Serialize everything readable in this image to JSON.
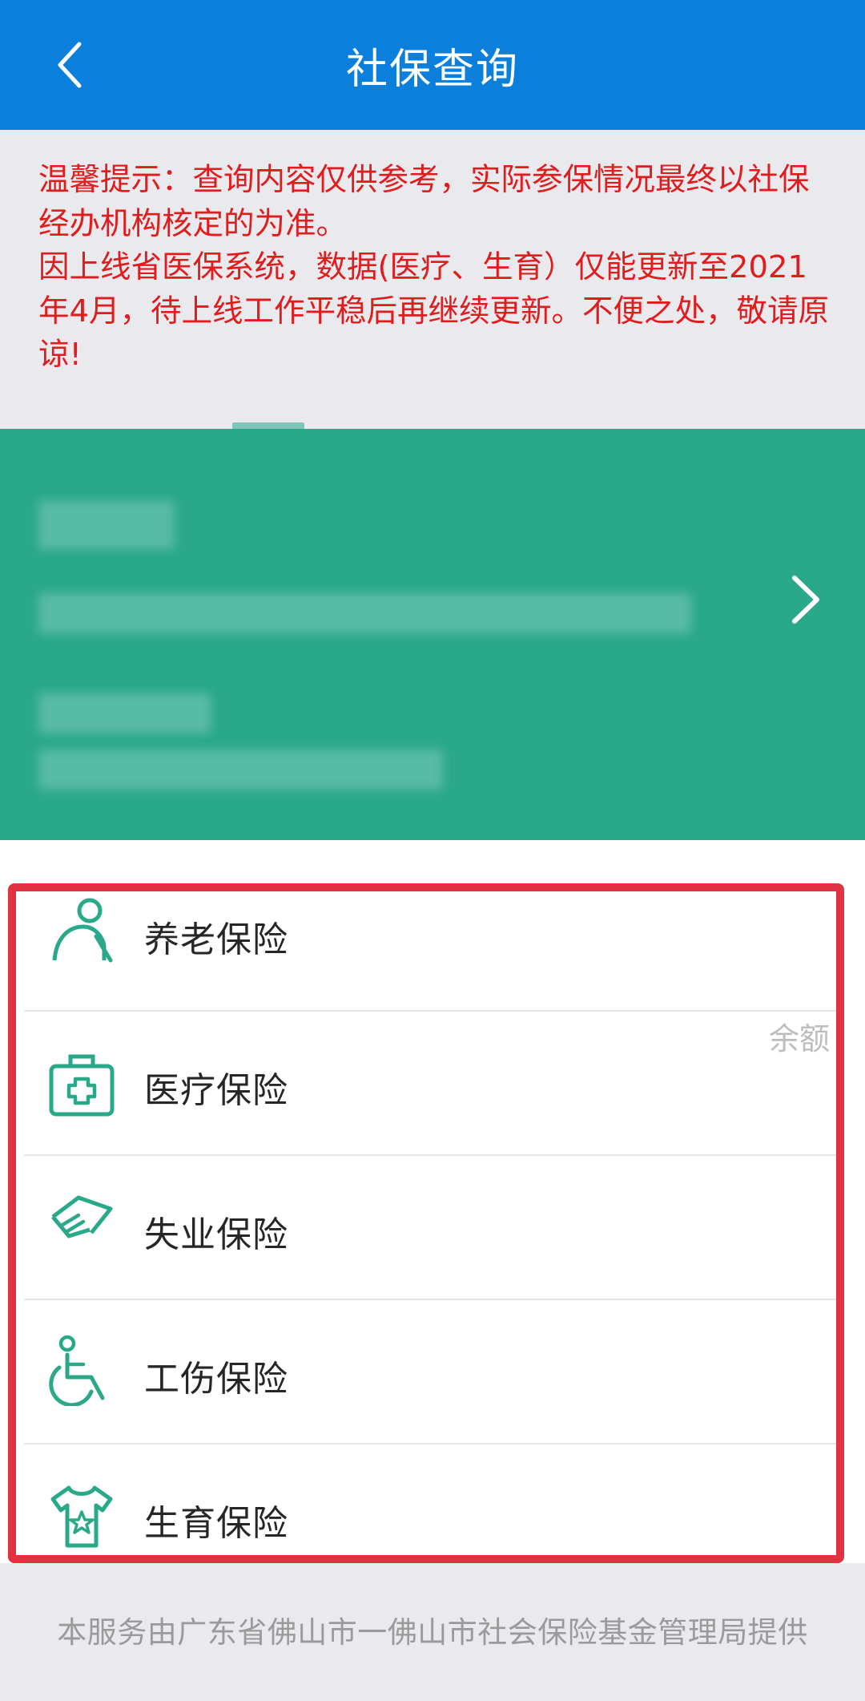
{
  "header": {
    "title": "社保查询"
  },
  "notice": {
    "text": "温馨提示：查询内容仅供参考，实际参保情况最终以社保经办机构核定的为准。\n因上线省医保系统，数据(医疗、生育）仅能更新至2021年4月，待上线工作平稳后再继续更新。不便之处，敬请原谅!"
  },
  "insurance": {
    "items": [
      {
        "label": "养老保险",
        "icon": "elderly-person-icon"
      },
      {
        "label": "医疗保险",
        "icon": "medical-kit-icon"
      },
      {
        "label": "失业保险",
        "icon": "hand-money-icon"
      },
      {
        "label": "工伤保险",
        "icon": "wheelchair-icon"
      },
      {
        "label": "生育保险",
        "icon": "baby-clothes-icon"
      }
    ],
    "balance_label": "余额"
  },
  "footer": {
    "text": "本服务由广东省佛山市一佛山市社会保险基金管理局提供"
  },
  "colors": {
    "header_bg": "#0a7fdc",
    "notice_text": "#e01c1c",
    "card_bg": "#2aa88a",
    "icon": "#2aa88a",
    "highlight_border": "#e0333f"
  }
}
